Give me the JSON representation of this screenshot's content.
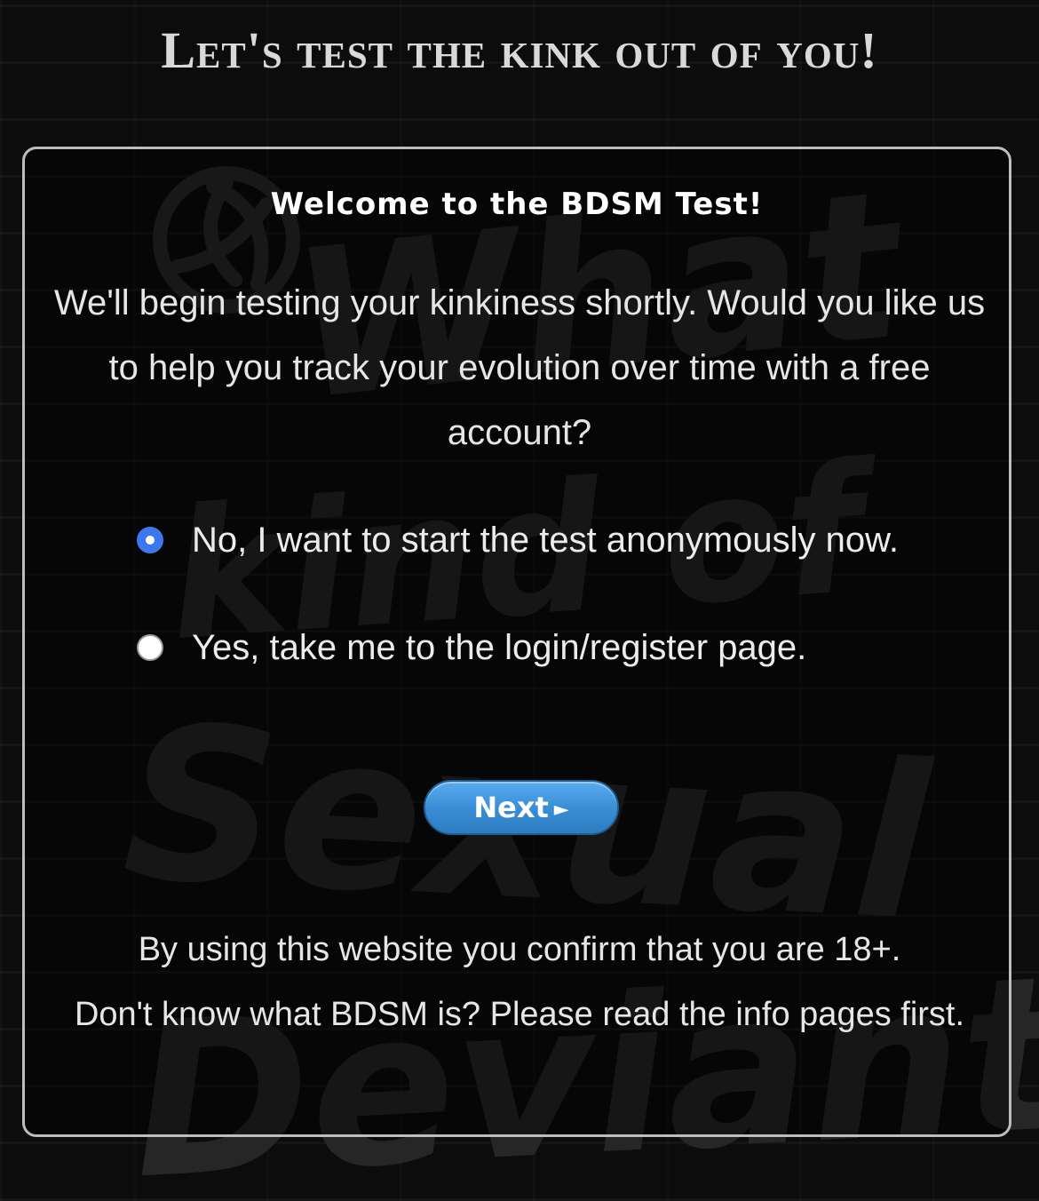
{
  "page": {
    "heading": "Let's test the kink out of you!"
  },
  "background": {
    "text_lines": [
      "What",
      "kind of",
      "Sexual",
      "Deviant"
    ]
  },
  "card": {
    "welcome": "Welcome to the BDSM Test!",
    "intro": "We'll begin testing your kinkiness shortly. Would you like us to help you track your evolution over time with a free account?",
    "options": [
      {
        "label": "No, I want to start the test anonymously now.",
        "checked": true
      },
      {
        "label": "Yes, take me to the login/register page.",
        "checked": false
      }
    ],
    "next_label": "Next",
    "next_icon": "►",
    "footer_line1": "By using this website you confirm that you are 18+.",
    "footer_line2": "Don't know what BDSM is? Please read the info pages first."
  },
  "colors": {
    "accent_radio": "#3b78ee",
    "button_blue": "#3a8fd6",
    "card_border": "#bdbdbd"
  }
}
